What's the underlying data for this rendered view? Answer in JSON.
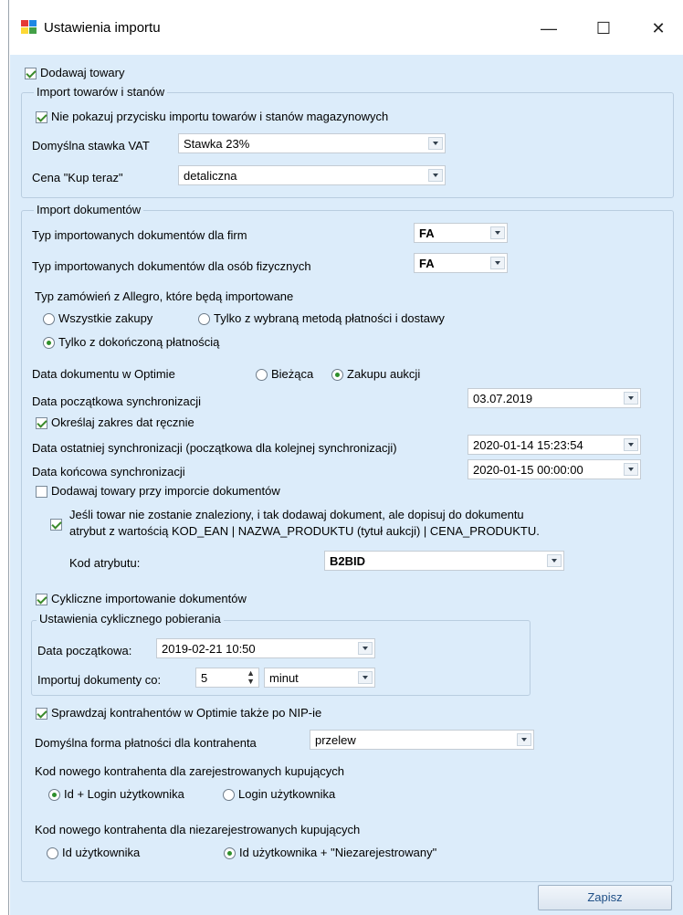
{
  "window": {
    "title": "Ustawienia importu",
    "minimize": "—",
    "maximize": "☐",
    "close": "✕"
  },
  "add_products": {
    "label": "Dodawaj towary",
    "checked": true
  },
  "products_group": {
    "title": "Import towarów i stanów",
    "hide_button": {
      "label": "Nie pokazuj przycisku importu towarów i stanów magazynowych",
      "checked": true
    },
    "vat_label": "Domyślna stawka VAT",
    "vat_value": "Stawka 23%",
    "price_label": "Cena \"Kup teraz\"",
    "price_value": "detaliczna"
  },
  "docs_group": {
    "title": "Import dokumentów",
    "type_companies_label": "Typ importowanych dokumentów dla firm",
    "type_companies_value": "FA",
    "type_persons_label": "Typ importowanych dokumentów dla osób fizycznych",
    "type_persons_value": "FA",
    "orders_label": "Typ zamówień z Allegro, które będą importowane",
    "orders_all": "Wszystkie zakupy",
    "orders_method": "Tylko z wybraną metodą płatności i dostawy",
    "orders_paid": "Tylko z dokończoną płatnością",
    "doc_date_label": "Data dokumentu w Optimie",
    "doc_date_current": "Bieżąca",
    "doc_date_auction": "Zakupu aukcji",
    "start_sync_label": "Data początkowa synchronizacji",
    "start_sync_value": "03.07.2019",
    "manual_range": {
      "label": "Określaj zakres dat ręcznie",
      "checked": true
    },
    "last_sync_label": "Data ostatniej synchronizacji (początkowa dla kolejnej synchronizacji)",
    "last_sync_value": "2020-01-14 15:23:54",
    "end_sync_label": "Data końcowa synchronizacji",
    "end_sync_value": "2020-01-15 00:00:00",
    "add_on_import": {
      "label": "Dodawaj towary przy imporcie dokumentów",
      "checked": false
    },
    "not_found": {
      "line1": "Jeśli towar nie zostanie znaleziony, i tak dodawaj dokument, ale dopisuj do dokumentu",
      "line2": "atrybut z wartością KOD_EAN | NAZWA_PRODUKTU (tytuł aukcji) | CENA_PRODUKTU.",
      "checked": true
    },
    "attr_code_label": "Kod atrybutu:",
    "attr_code_value": "B2BID",
    "cyclic": {
      "label": "Cykliczne importowanie dokumentów",
      "checked": true
    }
  },
  "cyclic_group": {
    "title": "Ustawienia cyklicznego pobierania",
    "start_label": "Data początkowa:",
    "start_value": "2019-02-21 10:50",
    "every_label": "Importuj dokumenty co:",
    "every_value": "5",
    "unit_value": "minut"
  },
  "contractors": {
    "nip_check": {
      "label": "Sprawdzaj kontrahentów w Optimie także po NIP-ie",
      "checked": true
    },
    "payment_label": "Domyślna forma płatności dla kontrahenta",
    "payment_value": "przelew",
    "registered_label": "Kod nowego kontrahenta dla zarejestrowanych kupujących",
    "registered_opt1": "Id + Login użytkownika",
    "registered_opt2": "Login użytkownika",
    "unregistered_label": "Kod nowego kontrahenta dla niezarejestrowanych kupujących",
    "unregistered_opt1": "Id użytkownika",
    "unregistered_opt2": "Id użytkownika + \"Niezarejestrowany\""
  },
  "save_button": "Zapisz",
  "colors": {
    "background": "#dcecfa",
    "accent": "#1f4f86",
    "check": "#3a8a2a"
  }
}
